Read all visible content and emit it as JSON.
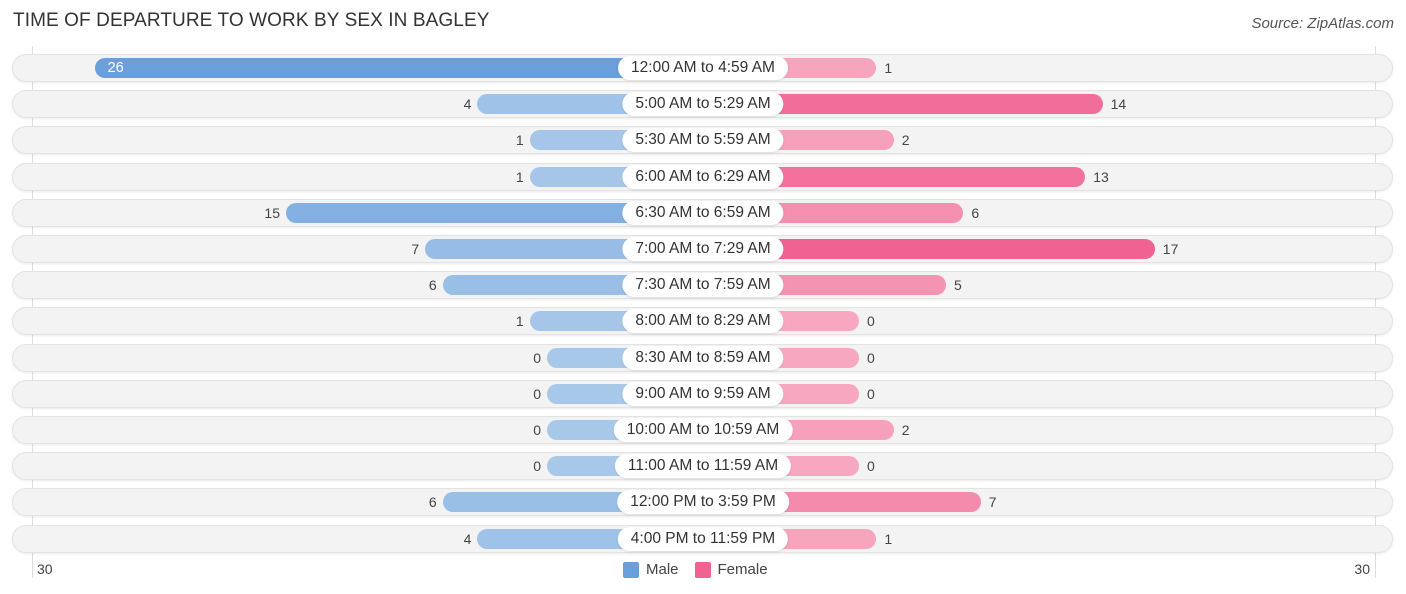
{
  "chart_data": {
    "type": "bar",
    "orientation": "horizontal-diverging",
    "title": "TIME OF DEPARTURE TO WORK BY SEX IN BAGLEY",
    "source": "Source: ZipAtlas.com",
    "categories": [
      "12:00 AM to 4:59 AM",
      "5:00 AM to 5:29 AM",
      "5:30 AM to 5:59 AM",
      "6:00 AM to 6:29 AM",
      "6:30 AM to 6:59 AM",
      "7:00 AM to 7:29 AM",
      "7:30 AM to 7:59 AM",
      "8:00 AM to 8:29 AM",
      "8:30 AM to 8:59 AM",
      "9:00 AM to 9:59 AM",
      "10:00 AM to 10:59 AM",
      "11:00 AM to 11:59 AM",
      "12:00 PM to 3:59 PM",
      "4:00 PM to 11:59 PM"
    ],
    "series": [
      {
        "name": "Male",
        "color": "#6a9fdb",
        "light_color": "#a8c8ea",
        "values": [
          26,
          4,
          1,
          1,
          15,
          7,
          6,
          1,
          0,
          0,
          0,
          0,
          6,
          4
        ]
      },
      {
        "name": "Female",
        "color": "#f06292",
        "light_color": "#f7a8c0",
        "values": [
          1,
          14,
          2,
          13,
          6,
          17,
          5,
          0,
          0,
          0,
          2,
          0,
          7,
          1
        ]
      }
    ],
    "axis": {
      "left_tick": "30",
      "right_tick": "30",
      "range": [
        -30,
        30
      ]
    },
    "legend": {
      "placement": "bottom-center",
      "entries": [
        "Male",
        "Female"
      ]
    },
    "xlabel": "",
    "ylabel": ""
  }
}
